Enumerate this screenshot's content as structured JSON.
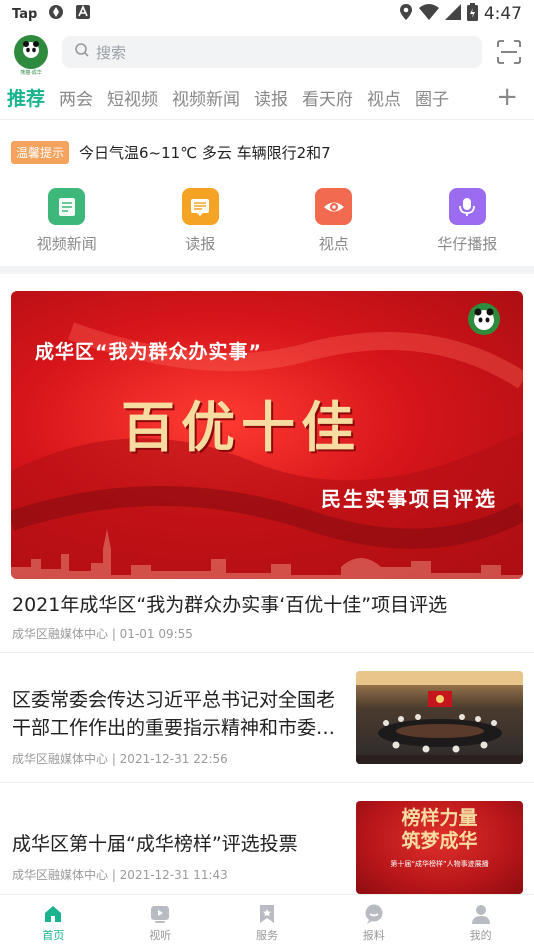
{
  "status_bar": {
    "left_label": "Tap",
    "time": "4:47",
    "icons": [
      "tap-indicator",
      "data-saver-icon",
      "font-a-icon",
      "location-icon",
      "wifi-icon",
      "signal-icon",
      "battery-icon"
    ]
  },
  "header": {
    "logo_caption": "熊猫·成华",
    "search_placeholder": "搜索",
    "scan_icon": "scan-icon"
  },
  "tabs": [
    {
      "label": "推荐",
      "active": true
    },
    {
      "label": "两会"
    },
    {
      "label": "短视频"
    },
    {
      "label": "视频新闻"
    },
    {
      "label": "读报"
    },
    {
      "label": "看天府"
    },
    {
      "label": "视点"
    },
    {
      "label": "圈子"
    }
  ],
  "notice": {
    "badge": "温馨提示",
    "text": "今日气温6~11℃  多云  车辆限行2和7"
  },
  "quick_links": [
    {
      "label": "视频新闻",
      "color": "#3db77a",
      "icon": "document-icon"
    },
    {
      "label": "读报",
      "color": "#f4a324",
      "icon": "newspaper-icon"
    },
    {
      "label": "视点",
      "color": "#f26b50",
      "icon": "eye-icon"
    },
    {
      "label": "华仔播报",
      "color": "#9b6cf0",
      "icon": "microphone-icon"
    }
  ],
  "banner": {
    "line1": "成华区“我为群众办实事”",
    "main": "百优十佳",
    "sub": "民生实事项目评选",
    "logo_caption": "熊猫·成华"
  },
  "feature_article": {
    "title": "2021年成华区“我为群众办实事‘百优十佳”项目评选",
    "meta": "成华区融媒体中心 | 01-01 09:55"
  },
  "articles": [
    {
      "title": "区委常委会传达习近平总书记对全国老干部工作作出的重要指示精神和市委…",
      "meta": "成华区融媒体中心 | 2021-12-31 22:56"
    },
    {
      "title": "成华区第十届“成华榜样”评选投票",
      "meta": "成华区融媒体中心 | 2021-12-31 11:43",
      "thumb_title_line1": "榜样力量",
      "thumb_title_line2": "筑梦成华",
      "thumb_sub": "第十届“成华榜样”人物事迹展播"
    }
  ],
  "bottom_nav": [
    {
      "label": "首页",
      "icon": "home-icon",
      "active": true
    },
    {
      "label": "视听",
      "icon": "play-icon"
    },
    {
      "label": "服务",
      "icon": "bookmark-icon"
    },
    {
      "label": "报料",
      "icon": "chat-icon"
    },
    {
      "label": "我的",
      "icon": "user-icon"
    }
  ],
  "colors": {
    "accent": "#19b48e",
    "banner_red": "#d6151a",
    "badge_orange": "#f4a25c"
  }
}
